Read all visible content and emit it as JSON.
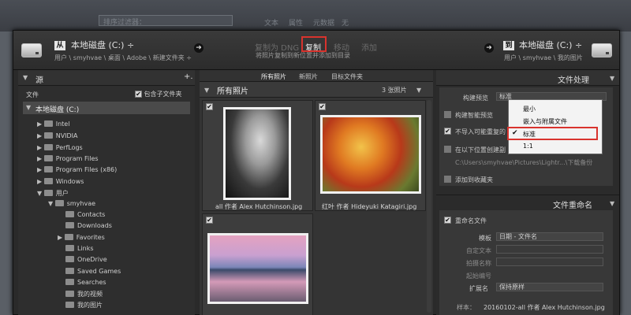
{
  "background_bar": {
    "labels": [
      "文本",
      "属性",
      "元数据",
      "无"
    ],
    "filter_label": "排序过滤器："
  },
  "topbar": {
    "source_badge": "从",
    "source_disk": "本地磁盘 (C:) ÷",
    "source_path": "用户 \\ smyhvae \\ 桌面 \\ Adobe \\ 新建文件夹 ÷",
    "modes": [
      "复制为 DNG",
      "复制",
      "移动",
      "添加"
    ],
    "subtitle": "将照片复制到新位置并添加到目录",
    "dest_badge": "到",
    "dest_disk": "本地磁盘 (C:) ÷",
    "dest_path": "用户 \\ smyhvae \\ 我的图片"
  },
  "left": {
    "header": "源",
    "plus": "+.",
    "files_label": "文件",
    "include_sub": "包含子文件夹",
    "drive": "本地磁盘 (C:)",
    "folders": [
      "Intel",
      "NVIDIA",
      "PerfLogs",
      "Program Files",
      "Program Files (x86)",
      "Windows",
      "用户",
      "smyhvae",
      "Contacts",
      "Downloads",
      "Favorites",
      "Links",
      "OneDrive",
      "Saved Games",
      "Searches",
      "我的视频",
      "我的图片"
    ]
  },
  "middle": {
    "tabs": [
      "所有照片",
      "新照片",
      "目标文件夹"
    ],
    "title": "所有照片",
    "count": "3 张照片",
    "photos": [
      {
        "caption": "all 作者 Alex Hutchinson.jpg"
      },
      {
        "caption": "红叶 作者 Hideyuki Katagiri.jpg"
      },
      {
        "caption": ""
      }
    ]
  },
  "right": {
    "file_handling": "文件处理",
    "build_preview_label": "构建预览",
    "build_preview_value": "标准",
    "smart_preview": "构建智能预览",
    "no_duplicates": "不导入可能重复的",
    "second_copy": "在以下位置创建副",
    "second_copy_path": "C:\\Users\\smyhvae\\Pictures\\Lightr...\\下载备份",
    "add_to_collection": "添加到收藏夹",
    "dropdown_options": [
      "最小",
      "嵌入与附属文件",
      "标准",
      "1:1"
    ],
    "file_rename": "文件重命名",
    "rename_files": "重命名文件",
    "template_label": "模板",
    "template_value": "日期 - 文件名",
    "custom_text": "自定文本",
    "shoot_name": "拍摄名称",
    "start_number": "起始编号",
    "extension_label": "扩展名",
    "extension_value": "保持原样",
    "sample_label": "样本：",
    "sample_value": "20160102-all 作者 Alex Hutchinson.jpg"
  }
}
